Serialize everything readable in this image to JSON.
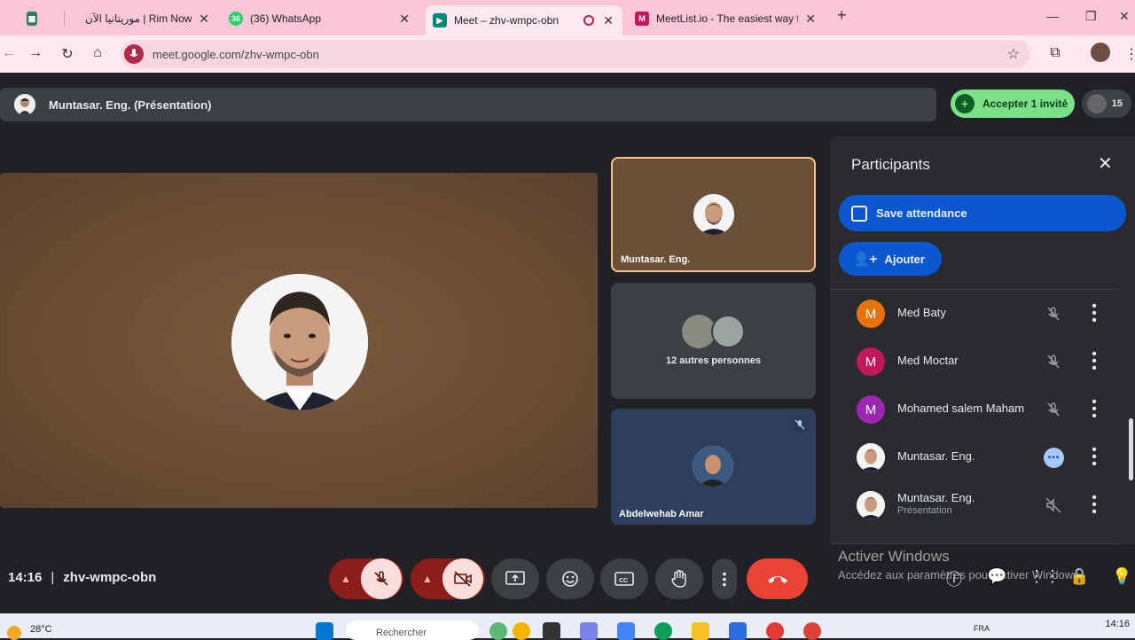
{
  "browser": {
    "tabs": [
      {
        "title": "",
        "favicon_color": "#2e7d5b"
      },
      {
        "title": "موريتانيا الآن | Rim Now",
        "favicon_color": "#f4a9c2"
      },
      {
        "title": "(36) WhatsApp",
        "favicon_color": "#25d366",
        "badge": "36"
      },
      {
        "title": "Meet – zhv-wmpc-obn",
        "favicon_color": "#00897b",
        "active": true
      },
      {
        "title": "MeetList.io - The easiest way to",
        "favicon_color": "#c2185b"
      }
    ],
    "new_tab": "+",
    "url": "meet.google.com/zhv-wmpc-obn",
    "window_controls": [
      "—",
      "❐",
      "✕"
    ]
  },
  "meet": {
    "presenter_bar_title": "Muntasar. Eng. (Présentation)",
    "accept_button": "Accepter 1 invité",
    "people_count": "15",
    "main_tile": {
      "name": ""
    },
    "side_tiles": [
      {
        "name": "Muntasar. Eng.",
        "highlight": true
      },
      {
        "name": "",
        "caption": "12 autres personnes"
      },
      {
        "name": "Abdelwehab Amar",
        "muted": true
      }
    ],
    "participants_panel": {
      "title": "Participants",
      "save_attendance": "Save attendance",
      "add_button": "Ajouter",
      "people": [
        {
          "initial": "M",
          "name": "Med Baty",
          "color": "#e8710a",
          "status": "muted"
        },
        {
          "initial": "M",
          "name": "Med Moctar",
          "color": "#c2185b",
          "status": "muted"
        },
        {
          "initial": "M",
          "name": "Mohamed salem Maham",
          "color": "#9c27b0",
          "status": "muted"
        },
        {
          "initial": "",
          "name": "Muntasar. Eng.",
          "color": "#dddddd",
          "status": "speaking"
        },
        {
          "initial": "",
          "name": "Muntasar. Eng.",
          "subtitle": "Présentation",
          "color": "#dddddd",
          "status": "audio-off"
        }
      ]
    },
    "meeting_time": "14:16",
    "meeting_code": "zhv-wmpc-obn",
    "windows_watermark": {
      "title": "Activer Windows",
      "subtitle": "Accédez aux paramètres pour activer Windows."
    }
  },
  "taskbar": {
    "temperature": "28°C",
    "search_placeholder": "Rechercher",
    "language": "FRA",
    "clock": "14:16"
  },
  "colors": {
    "tab_strip": "#f9c6d8",
    "meet_bg": "#202124",
    "hangup": "#ea4335",
    "accept_green": "#7be087",
    "primary_blue": "#0b57d0"
  }
}
